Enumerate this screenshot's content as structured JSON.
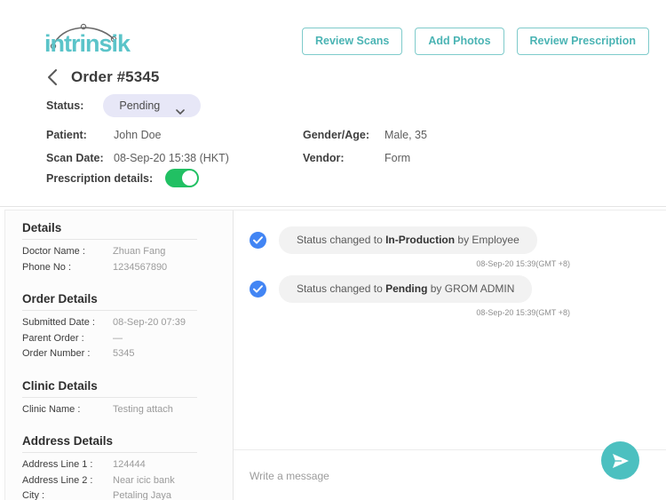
{
  "brand": {
    "logo_text": "intrinsik",
    "logo_color_dark": "#4a4a4a",
    "logo_color_accent": "#5bc4c9"
  },
  "header": {
    "actions": [
      {
        "label": "Review Scans",
        "name": "review-scans-button"
      },
      {
        "label": "Add Photos",
        "name": "add-photos-button"
      },
      {
        "label": "Review Prescription",
        "name": "review-prescription-button"
      }
    ],
    "back_icon": "chevron-left-icon",
    "order_title": "Order #5345",
    "status": {
      "label": "Status:",
      "value": "Pending",
      "pill_bg": "#e7e7f7",
      "caret_icon": "chevron-down-icon"
    },
    "fields_left": [
      {
        "label": "Patient:",
        "value": "John Doe"
      },
      {
        "label": "Scan Date:",
        "value": "08-Sep-20 15:38 (HKT)"
      }
    ],
    "fields_right": [
      {
        "label": "Gender/Age:",
        "value": "Male, 35"
      },
      {
        "label": "Vendor:",
        "value": "Form"
      }
    ],
    "prescription": {
      "label": "Prescription details:",
      "toggle_on": true,
      "toggle_color": "#21c063"
    }
  },
  "sidebar": {
    "sections": [
      {
        "title": "Details",
        "rows": [
          {
            "key": "Doctor Name :",
            "value": "Zhuan Fang"
          },
          {
            "key": "Phone No :",
            "value": "1234567890"
          }
        ]
      },
      {
        "title": "Order Details",
        "rows": [
          {
            "key": "Submitted Date :",
            "value": "08-Sep-20 07:39"
          },
          {
            "key": "Parent Order :",
            "value": "—"
          },
          {
            "key": "Order Number :",
            "value": "5345"
          }
        ]
      },
      {
        "title": "Clinic Details",
        "rows": [
          {
            "key": "Clinic Name :",
            "value": "Testing attach"
          }
        ]
      },
      {
        "title": "Address Details",
        "rows": [
          {
            "key": "Address Line 1 :",
            "value": "124444"
          },
          {
            "key": "Address Line 2 :",
            "value": "Near icic bank"
          },
          {
            "key": "City :",
            "value": "Petaling Jaya"
          }
        ]
      }
    ]
  },
  "activity": {
    "items": [
      {
        "icon": "check-circle-icon",
        "text_before": "Status changed to ",
        "text_bold": "In-Production",
        "text_after": " by Employee",
        "timestamp": "08-Sep-20 15:39(GMT +8)"
      },
      {
        "icon": "check-circle-icon",
        "text_before": "Status changed to ",
        "text_bold": "Pending",
        "text_after": " by GROM ADMIN",
        "timestamp": "08-Sep-20 15:39(GMT +8)"
      }
    ],
    "composer": {
      "placeholder": "Write a message",
      "value": "",
      "send_icon": "send-paper-plane-icon",
      "send_color": "#4cc0c0"
    }
  }
}
